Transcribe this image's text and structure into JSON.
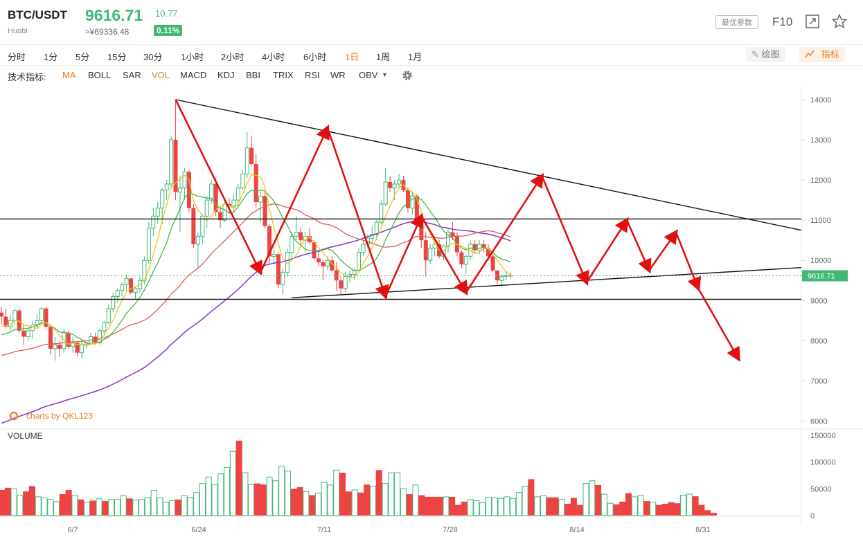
{
  "header": {
    "pair": "BTC/USDT",
    "exchange": "Huobi",
    "price": "9616.71",
    "cny_price": "≈¥69336.48",
    "change": "10.77",
    "change_pct": "0.11%",
    "optimal_params": "最优参数",
    "f10": "F10",
    "expand_icon": "expand-icon",
    "star_icon": "star-icon"
  },
  "timeframes": [
    "分时",
    "1分",
    "5分",
    "15分",
    "30分",
    "1小时",
    "2小时",
    "4小时",
    "6小时",
    "1日",
    "1周",
    "1月"
  ],
  "active_timeframe": "1日",
  "toolbar": {
    "draw": "绘图",
    "indicator": "指标"
  },
  "indicators": {
    "label": "技术指标:",
    "items": [
      "MA",
      "BOLL",
      "SAR",
      "VOL",
      "MACD",
      "KDJ",
      "BBI",
      "TRIX",
      "RSI",
      "WR",
      "OBV"
    ],
    "active": [
      "MA",
      "VOL"
    ],
    "settings_icon": "gear-icon"
  },
  "colors": {
    "up": "#3fb876",
    "down": "#ee4343",
    "accent": "#e67e22",
    "ma5": "#f0c419",
    "ma10": "#3fb846",
    "ma30": "#e05a5a",
    "ma60": "#8a3fd0",
    "arrow": "#e01010"
  },
  "chart_data": {
    "type": "candlestick",
    "y_ticks": [
      14000,
      13000,
      12000,
      11000,
      10000,
      9000,
      8000,
      7000,
      6000
    ],
    "ylim": [
      5800,
      14300
    ],
    "x_labels": [
      "6/7",
      "6/24",
      "7/11",
      "7/28",
      "8/14",
      "8/31"
    ],
    "last_price_label": "9616.71",
    "watermark": "charts by QKL123",
    "volume": {
      "title": "VOLUME",
      "y_ticks": [
        150000,
        100000,
        50000,
        0
      ]
    },
    "ohlc": [
      [
        8700,
        8850,
        8400,
        8600
      ],
      [
        8600,
        8800,
        8300,
        8350
      ],
      [
        8350,
        8650,
        8250,
        8500
      ],
      [
        8500,
        8800,
        8400,
        8750
      ],
      [
        8750,
        8800,
        8200,
        8250
      ],
      [
        8250,
        8400,
        7900,
        8100
      ],
      [
        8100,
        8300,
        8000,
        8250
      ],
      [
        8250,
        8500,
        8050,
        8400
      ],
      [
        8400,
        8650,
        8300,
        8500
      ],
      [
        8500,
        8850,
        8400,
        8800
      ],
      [
        8800,
        8850,
        8300,
        8350
      ],
      [
        8350,
        8400,
        7650,
        7800
      ],
      [
        7800,
        8100,
        7500,
        7900
      ],
      [
        7900,
        8000,
        7600,
        7800
      ],
      [
        7800,
        8300,
        7700,
        8200
      ],
      [
        8200,
        8250,
        7800,
        7850
      ],
      [
        7850,
        8100,
        7700,
        7950
      ],
      [
        7950,
        7950,
        7600,
        7700
      ],
      [
        7700,
        8000,
        7550,
        7900
      ],
      [
        7900,
        8000,
        7800,
        7950
      ],
      [
        7950,
        8200,
        7900,
        8100
      ],
      [
        8100,
        8200,
        7900,
        7950
      ],
      [
        7950,
        8300,
        7900,
        8250
      ],
      [
        8250,
        8500,
        8150,
        8450
      ],
      [
        8450,
        8900,
        8400,
        8800
      ],
      [
        8800,
        9200,
        8700,
        9100
      ],
      [
        9100,
        9300,
        8950,
        9250
      ],
      [
        9250,
        9450,
        9100,
        9400
      ],
      [
        9400,
        9650,
        9250,
        9550
      ],
      [
        9550,
        9550,
        9150,
        9200
      ],
      [
        9200,
        9350,
        9050,
        9300
      ],
      [
        9300,
        9600,
        9200,
        9500
      ],
      [
        9500,
        10100,
        9400,
        10000
      ],
      [
        10000,
        10950,
        9900,
        10800
      ],
      [
        10800,
        11300,
        10600,
        11100
      ],
      [
        11100,
        11450,
        10900,
        11300
      ],
      [
        11300,
        11800,
        10900,
        11750
      ],
      [
        11750,
        12000,
        11500,
        11900
      ],
      [
        11900,
        13100,
        11800,
        13000
      ],
      [
        13000,
        14000,
        11500,
        11700
      ],
      [
        11700,
        12100,
        10700,
        11800
      ],
      [
        11800,
        12300,
        11500,
        12200
      ],
      [
        12200,
        12250,
        11200,
        11300
      ],
      [
        11300,
        11400,
        10300,
        10400
      ],
      [
        10400,
        10700,
        9800,
        10600
      ],
      [
        10600,
        11150,
        10400,
        11100
      ],
      [
        11100,
        11600,
        10800,
        11500
      ],
      [
        11500,
        12000,
        11400,
        11900
      ],
      [
        11900,
        12050,
        11100,
        11200
      ],
      [
        11200,
        11350,
        10800,
        11000
      ],
      [
        11000,
        11500,
        10950,
        11400
      ],
      [
        11400,
        11550,
        11150,
        11350
      ],
      [
        11350,
        11650,
        11200,
        11500
      ],
      [
        11500,
        11900,
        11350,
        11800
      ],
      [
        11800,
        12250,
        11750,
        12150
      ],
      [
        12150,
        13200,
        12050,
        12800
      ],
      [
        12800,
        13100,
        12350,
        12400
      ],
      [
        12400,
        12650,
        11300,
        11450
      ],
      [
        11450,
        11700,
        10950,
        11600
      ],
      [
        11600,
        11700,
        10800,
        10850
      ],
      [
        10850,
        10900,
        9900,
        10100
      ],
      [
        10100,
        10300,
        9900,
        10150
      ],
      [
        10150,
        10200,
        9300,
        9400
      ],
      [
        9400,
        9800,
        9150,
        9700
      ],
      [
        9700,
        10300,
        9600,
        10200
      ],
      [
        10200,
        10700,
        10050,
        10600
      ],
      [
        10600,
        11100,
        10500,
        10700
      ],
      [
        10700,
        10800,
        10350,
        10500
      ],
      [
        10500,
        10700,
        10200,
        10600
      ],
      [
        10600,
        10800,
        10400,
        10450
      ],
      [
        10450,
        10500,
        10000,
        10050
      ],
      [
        10050,
        10200,
        9850,
        9950
      ],
      [
        9950,
        10000,
        9500,
        9850
      ],
      [
        9850,
        10100,
        9750,
        10000
      ],
      [
        10000,
        10100,
        9700,
        9750
      ],
      [
        9750,
        9950,
        9250,
        9500
      ],
      [
        9500,
        9600,
        9150,
        9300
      ],
      [
        9300,
        9700,
        9200,
        9600
      ],
      [
        9600,
        9750,
        9450,
        9650
      ],
      [
        9650,
        9800,
        9500,
        9750
      ],
      [
        9750,
        10300,
        9700,
        10200
      ],
      [
        10200,
        10500,
        10100,
        10400
      ],
      [
        10400,
        10650,
        10300,
        10550
      ],
      [
        10550,
        10850,
        10400,
        10650
      ],
      [
        10650,
        11000,
        10500,
        10950
      ],
      [
        10950,
        11500,
        10900,
        11400
      ],
      [
        11400,
        12300,
        11350,
        11950
      ],
      [
        11950,
        12100,
        11700,
        11800
      ],
      [
        11800,
        12000,
        11500,
        11900
      ],
      [
        11900,
        12150,
        11800,
        12000
      ],
      [
        12000,
        12100,
        11700,
        11750
      ],
      [
        11750,
        11800,
        11200,
        11300
      ],
      [
        11300,
        11700,
        11150,
        11600
      ],
      [
        11600,
        11650,
        10900,
        11000
      ],
      [
        11000,
        11150,
        10300,
        10500
      ],
      [
        10500,
        10700,
        9600,
        10000
      ],
      [
        10000,
        10400,
        9900,
        10300
      ],
      [
        10300,
        10500,
        10100,
        10400
      ],
      [
        10400,
        10500,
        10050,
        10100
      ],
      [
        10100,
        10400,
        10000,
        10350
      ],
      [
        10350,
        10800,
        10200,
        10700
      ],
      [
        10700,
        10950,
        10500,
        10600
      ],
      [
        10600,
        10700,
        10100,
        10200
      ],
      [
        10200,
        10250,
        9800,
        9900
      ],
      [
        9900,
        10150,
        9650,
        10100
      ],
      [
        10100,
        10500,
        10000,
        10400
      ],
      [
        10400,
        10500,
        10150,
        10250
      ],
      [
        10250,
        10500,
        10150,
        10400
      ],
      [
        10400,
        10500,
        10200,
        10300
      ],
      [
        10300,
        10400,
        10000,
        10100
      ],
      [
        10100,
        10200,
        9700,
        9750
      ],
      [
        9750,
        9750,
        9400,
        9500
      ],
      [
        9500,
        9650,
        9350,
        9600
      ],
      [
        9600,
        9700,
        9500,
        9620
      ],
      [
        9620,
        9700,
        9550,
        9617
      ]
    ],
    "vol": [
      48000,
      52000,
      50000,
      38000,
      45000,
      55000,
      35000,
      33000,
      30000,
      26000,
      40000,
      48000,
      38000,
      30000,
      25000,
      28000,
      32000,
      27000,
      30000,
      30000,
      37000,
      32000,
      29000,
      30000,
      34000,
      47000,
      33000,
      25000,
      28000,
      30000,
      37000,
      34000,
      43000,
      60000,
      72000,
      58000,
      78000,
      90000,
      120000,
      140000,
      80000,
      58000,
      60000,
      58000,
      72000,
      65000,
      92000,
      83000,
      50000,
      53000,
      45000,
      38000,
      42000,
      62000,
      57000,
      85000,
      80000,
      45000,
      48000,
      43000,
      58000,
      55000,
      85000,
      60000,
      80000,
      80000,
      50000,
      40000,
      57000,
      38000,
      35000,
      35000,
      35000,
      35000,
      35000,
      20000,
      26000,
      30000,
      28000,
      24000,
      34000,
      33000,
      32000,
      35000,
      32000,
      43000,
      55000,
      68000,
      35000,
      37000,
      34000,
      34000,
      30000,
      22000,
      33000,
      20000,
      60000,
      65000,
      57000,
      40000,
      23000,
      21000,
      26000,
      42000,
      35000,
      38000,
      27000,
      25000,
      20000,
      22000,
      25000,
      23000,
      38000,
      40000,
      36000,
      20000,
      10000,
      5000
    ],
    "hlines": [
      11030,
      9030
    ],
    "trendlines": [
      {
        "from": [
          39,
          14000
        ],
        "to": [
          "right",
          10750
        ]
      },
      {
        "from": [
          65,
          9070
        ],
        "to": [
          "right",
          9820
        ]
      }
    ],
    "zigzag": [
      [
        39,
        14000
      ],
      [
        58,
        9700
      ],
      [
        73,
        13300
      ],
      [
        86,
        9100
      ],
      [
        94,
        11100
      ],
      [
        104,
        9200
      ],
      [
        121,
        12100
      ],
      [
        131,
        9450
      ],
      [
        140,
        11000
      ],
      [
        145,
        9750
      ],
      [
        151,
        10700
      ],
      [
        156,
        9300
      ],
      [
        165,
        7550
      ]
    ]
  }
}
